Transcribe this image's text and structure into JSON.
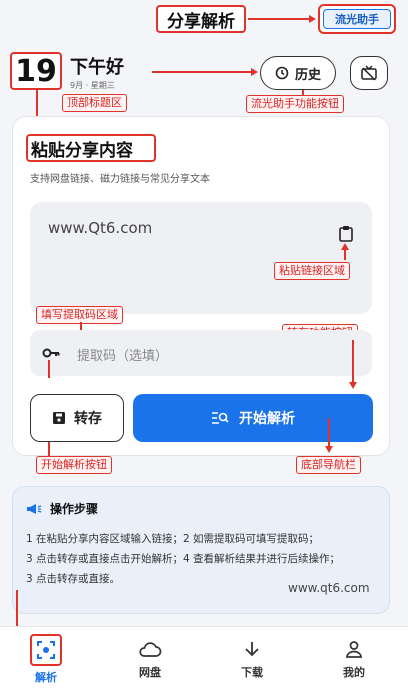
{
  "header": {
    "date_day": "19",
    "greeting": "下午好",
    "subdate": "9月 · 星期三",
    "history_label": "历史"
  },
  "annotations": {
    "page_title": "分享解析",
    "brand_tag": "流光助手",
    "top_title_area": "顶部标题区",
    "feature_buttons": "流光助手功能按钮",
    "paste_link_area": "粘贴链接区域",
    "fill_code_area": "填写提取码区域",
    "save_buttons": "转存功能按钮",
    "start_parse_button": "开始解析按钮",
    "bottom_nav": "底部导航栏"
  },
  "card": {
    "title": "粘贴分享内容",
    "subtitle": "支持网盘链接、磁力链接与常见分享文本",
    "link_value": "www.Qt6.com",
    "code_placeholder": "提取码（选填）",
    "save_label": "转存",
    "parse_label": "开始解析"
  },
  "steps": {
    "title": "操作步骤",
    "line1": "1 在粘贴分享内容区域输入链接；2 如需提取码可填写提取码；",
    "line2": "3 点击转存或直接点击开始解析；4 查看解析结果并进行后续操作；",
    "line3": "3 点击转存或直接。",
    "watermark": "www.qt6.com"
  },
  "nav": {
    "items": [
      {
        "label": "解析",
        "icon": "scan-icon"
      },
      {
        "label": "网盘",
        "icon": "cloud-icon"
      },
      {
        "label": "下载",
        "icon": "download-icon"
      },
      {
        "label": "我的",
        "icon": "user-icon"
      }
    ]
  },
  "colors": {
    "accent": "#1a73e8",
    "annotation": "#e0332a"
  }
}
